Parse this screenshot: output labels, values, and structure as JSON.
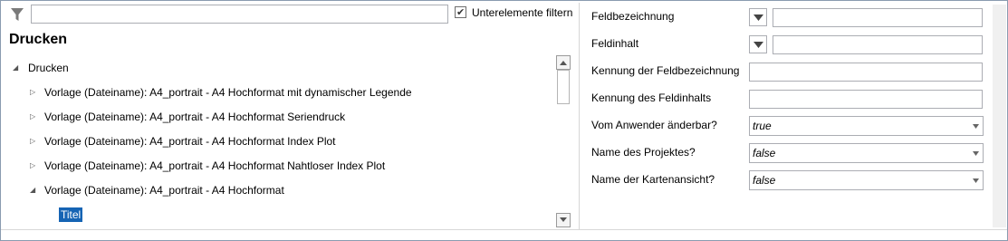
{
  "filter": {
    "value": "",
    "checkbox_label": "Unterelemente filtern",
    "checkbox_checked": true
  },
  "panel_title": "Drucken",
  "tree": {
    "root": "Drucken",
    "items": [
      {
        "label": "Vorlage (Dateiname): A4_portrait - A4 Hochformat mit dynamischer Legende",
        "expanded": false
      },
      {
        "label": "Vorlage (Dateiname): A4_portrait - A4 Hochformat Seriendruck",
        "expanded": false
      },
      {
        "label": "Vorlage (Dateiname): A4_portrait - A4 Hochformat Index Plot",
        "expanded": false
      },
      {
        "label": "Vorlage (Dateiname): A4_portrait - A4 Hochformat Nahtloser Index Plot",
        "expanded": false
      },
      {
        "label": "Vorlage (Dateiname): A4_portrait - A4 Hochformat",
        "expanded": true
      }
    ],
    "selected_child": "Titel"
  },
  "properties": {
    "feldbezeichnung_label": "Feldbezeichnung",
    "feldbezeichnung_value": "",
    "feldinhalt_label": "Feldinhalt",
    "feldinhalt_value": "",
    "kennung_bez_label": "Kennung der Feldbezeichnung",
    "kennung_bez_value": "",
    "kennung_inhalt_label": "Kennung des Feldinhalts",
    "kennung_inhalt_value": "",
    "anwender_label": "Vom Anwender änderbar?",
    "anwender_value": "true",
    "projekt_label": "Name des Projektes?",
    "projekt_value": "false",
    "karte_label": "Name der Kartenansicht?",
    "karte_value": "false"
  },
  "colors": {
    "selection": "#1664b4",
    "border": "#abadb3"
  }
}
